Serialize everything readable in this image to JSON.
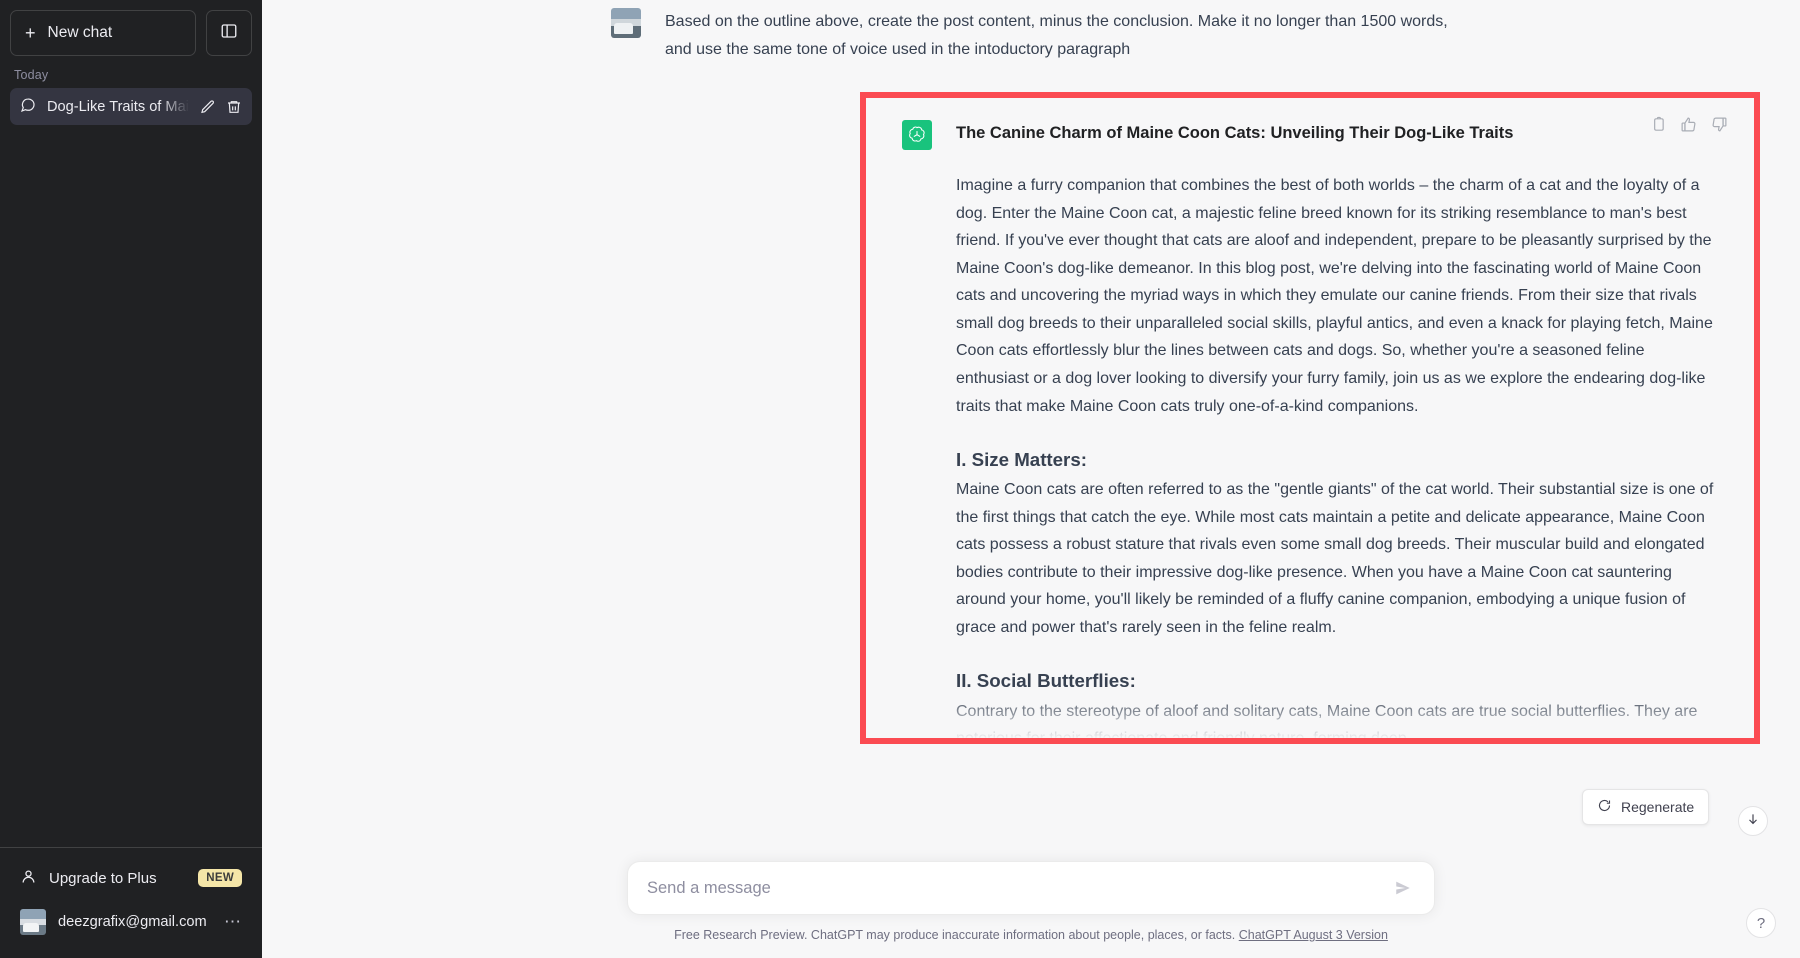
{
  "sidebar": {
    "new_chat_label": "New chat",
    "new_chat_icon": "plus-icon",
    "collapse_icon": "sidebar-collapse-icon",
    "history_group_label": "Today",
    "chats": [
      {
        "title": "Dog-Like Traits of Main",
        "chat_icon": "message-bubble-icon",
        "edit_icon": "pencil-icon",
        "delete_icon": "trash-icon",
        "active": true
      }
    ],
    "upgrade": {
      "label": "Upgrade to Plus",
      "icon": "person-icon",
      "badge": "NEW"
    },
    "account": {
      "email": "deezgrafix@gmail.com",
      "avatar": "user-photo-avatar",
      "menu_icon": "ellipsis-icon"
    }
  },
  "conversation": {
    "user_message": {
      "avatar": "user-photo-avatar",
      "text": "Based on the outline above, create the post content, minus the conclusion. Make it no longer than 1500 words, and use the same tone of voice used in the intoductory paragraph"
    },
    "assistant_message": {
      "avatar": "openai-logo-icon",
      "title": "The Canine Charm of Maine Coon Cats: Unveiling Their Dog-Like Traits",
      "intro": "Imagine a furry companion that combines the best of both worlds – the charm of a cat and the loyalty of a dog. Enter the Maine Coon cat, a majestic feline breed known for its striking resemblance to man's best friend. If you've ever thought that cats are aloof and independent, prepare to be pleasantly surprised by the Maine Coon's dog-like demeanor. In this blog post, we're delving into the fascinating world of Maine Coon cats and uncovering the myriad ways in which they emulate our canine friends. From their size that rivals small dog breeds to their unparalleled social skills, playful antics, and even a knack for playing fetch, Maine Coon cats effortlessly blur the lines between cats and dogs. So, whether you're a seasoned feline enthusiast or a dog lover looking to diversify your furry family, join us as we explore the endearing dog-like traits that make Maine Coon cats truly one-of-a-kind companions.",
      "sections": [
        {
          "heading": "I. Size Matters:",
          "body": "Maine Coon cats are often referred to as the \"gentle giants\" of the cat world. Their substantial size is one of the first things that catch the eye. While most cats maintain a petite and delicate appearance, Maine Coon cats possess a robust stature that rivals even some small dog breeds. Their muscular build and elongated bodies contribute to their impressive dog-like presence. When you have a Maine Coon cat sauntering around your home, you'll likely be reminded of a fluffy canine companion, embodying a unique fusion of grace and power that's rarely seen in the feline realm."
        },
        {
          "heading": "II. Social Butterflies:",
          "body": "Contrary to the stereotype of aloof and solitary cats, Maine Coon cats are true social butterflies. They are notorious for their affectionate and friendly nature, forming deep"
        }
      ],
      "actions": [
        {
          "name": "copy-icon",
          "label": "Copy"
        },
        {
          "name": "thumbs-up-icon",
          "label": "Good response"
        },
        {
          "name": "thumbs-down-icon",
          "label": "Bad response"
        }
      ]
    }
  },
  "regenerate": {
    "label": "Regenerate",
    "icon": "refresh-icon"
  },
  "composer": {
    "placeholder": "Send a message",
    "value": "",
    "send_icon": "send-arrow-icon"
  },
  "footer": {
    "disclaimer": "Free Research Preview. ChatGPT may produce inaccurate information about people, places, or facts.",
    "version_link": "ChatGPT August 3 Version"
  },
  "floating": {
    "scroll_down_icon": "arrow-down-icon",
    "help_label": "?"
  },
  "colors": {
    "highlight_border": "#fb4b52",
    "sidebar_bg": "#202123",
    "main_bg": "#f7f7f8",
    "brand_green": "#19c37d",
    "badge_yellow": "#f5e6a8"
  }
}
